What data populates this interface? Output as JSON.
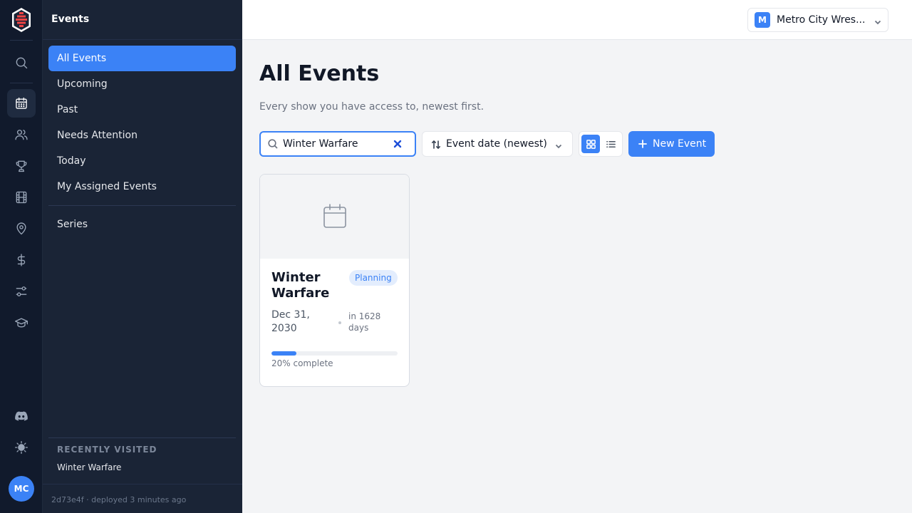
{
  "sidebar": {
    "title": "Events",
    "items": [
      {
        "label": "All Events",
        "active": true
      },
      {
        "label": "Upcoming"
      },
      {
        "label": "Past"
      },
      {
        "label": "Needs Attention"
      },
      {
        "label": "Today"
      },
      {
        "label": "My Assigned Events"
      },
      {
        "label": "Series"
      }
    ],
    "recent_title": "RECENTLY VISITED",
    "recent_items": [
      "Winter Warfare"
    ],
    "deploy_info": "2d73e4f · deployed 3 minutes ago"
  },
  "rail": {
    "icons": [
      "logo-icon",
      "search-icon",
      "calendar-icon",
      "people-icon",
      "trophy-icon",
      "film-icon",
      "location-pin-icon",
      "dollar-icon",
      "sliders-icon",
      "graduation-cap-icon",
      "discord-icon",
      "theme-sun-icon"
    ],
    "active": "calendar-icon",
    "avatar_initials": "MC"
  },
  "topbar": {
    "org_initial": "M",
    "org_name": "Metro City Wres..."
  },
  "main": {
    "title": "All Events",
    "subtitle": "Every show you have access to, newest first.",
    "search_value": "Winter Warfare",
    "sort_label": "Event date (newest)",
    "view_mode": "grid",
    "new_button_label": "New Event"
  },
  "events": [
    {
      "title": "Winter Warfare",
      "status": "Planning",
      "date": "Dec 31, 2030",
      "relative": "in 1628 days",
      "progress_percent": 20,
      "progress_label": "20% complete"
    }
  ],
  "colors": {
    "accent": "#3b82f6",
    "rail_bg": "#111a2c",
    "sidebar_bg": "#1a2436",
    "page_bg": "#f3f4f6"
  }
}
